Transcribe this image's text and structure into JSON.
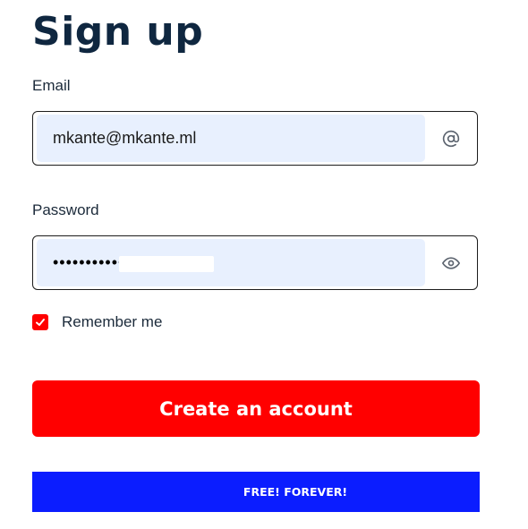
{
  "page": {
    "title": "Sign up"
  },
  "form": {
    "email": {
      "label": "Email",
      "value": "mkante@mkante.ml",
      "icon": "at-sign-icon"
    },
    "password": {
      "label": "Password",
      "masked_value": "•••••••••••",
      "icon": "eye-icon"
    },
    "remember": {
      "label": "Remember me",
      "checked": true
    },
    "submit_label": "Create an account"
  },
  "banner": {
    "text": "FREE! FOREVER!"
  },
  "colors": {
    "accent": "#ff0000",
    "banner": "#0b1dff",
    "input_fill": "#e8f0fe",
    "title": "#0f2740"
  }
}
